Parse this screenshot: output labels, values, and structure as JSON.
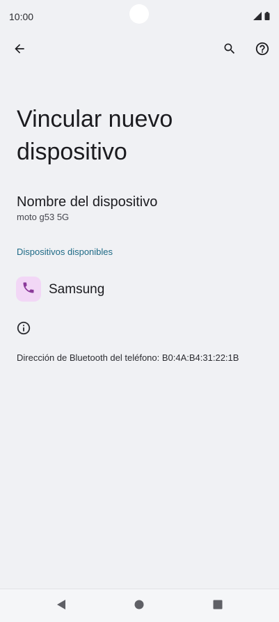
{
  "status_bar": {
    "time": "10:00",
    "signal_icon": "signal-icon",
    "battery_icon": "battery-icon"
  },
  "top_bar": {
    "back_icon": "arrow-back-icon",
    "search_icon": "search-icon",
    "help_icon": "help-icon"
  },
  "page": {
    "title": "Vincular nuevo dispositivo"
  },
  "device_name": {
    "title": "Nombre del dispositivo",
    "value": "moto g53 5G"
  },
  "available_devices": {
    "header": "Dispositivos disponibles",
    "items": [
      {
        "label": "Samsung",
        "icon": "phone-icon"
      }
    ]
  },
  "info": {
    "icon": "info-icon",
    "bluetooth_address": "Dirección de Bluetooth del teléfono: B0:4A:B4:31:22:1B"
  },
  "colors": {
    "background": "#f0f1f4",
    "accent": "#1e6a86",
    "device_icon_bg": "#f2d7f6",
    "device_icon_fg": "#8b3a9a"
  }
}
